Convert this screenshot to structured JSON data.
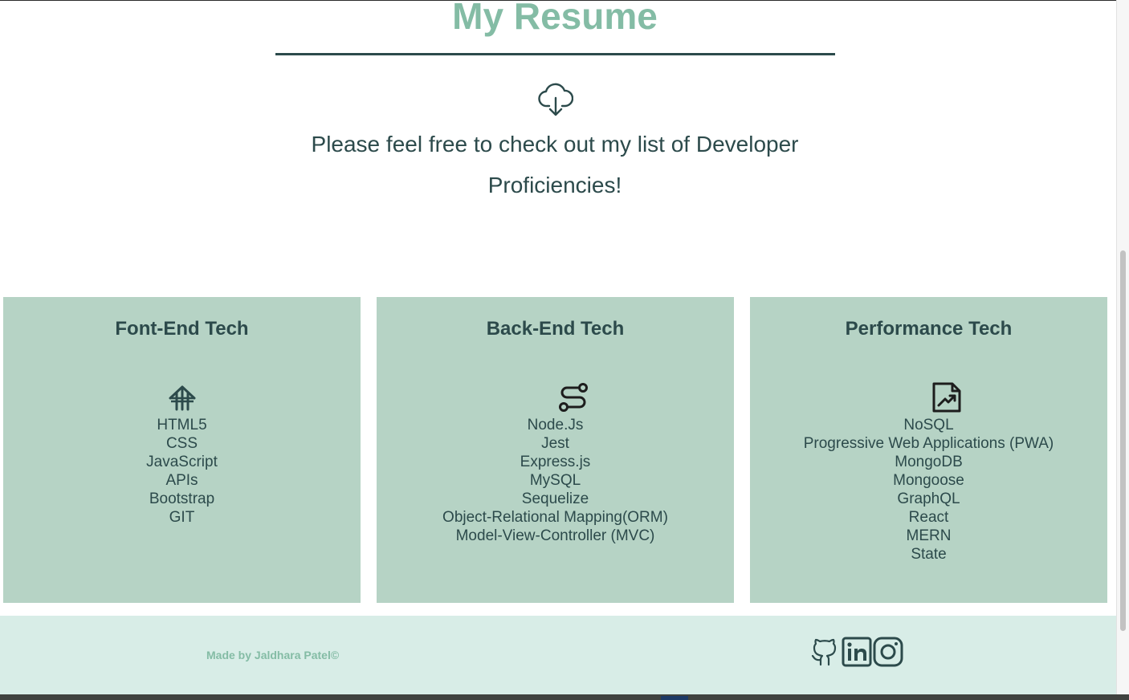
{
  "header": {
    "title": "My Resume",
    "download_icon": "cloud-download-icon",
    "intro_line1": "Please feel free to check out my list of Developer",
    "intro_line2": "Proficiencies!"
  },
  "cards": [
    {
      "title": "Font-End Tech",
      "icon": "frontend-icon",
      "items": [
        "HTML5",
        "CSS",
        "JavaScript",
        "APIs",
        "Bootstrap",
        "GIT"
      ]
    },
    {
      "title": "Back-End Tech",
      "icon": "route-icon",
      "items": [
        "Node.Js",
        "Jest",
        "Express.js",
        "MySQL",
        "Sequelize",
        "Object-Relational Mapping(ORM)",
        "Model-View-Controller (MVC)"
      ]
    },
    {
      "title": "Performance Tech",
      "icon": "file-chart-icon",
      "items": [
        "NoSQL",
        "Progressive Web Applications (PWA)",
        "MongoDB",
        "Mongoose",
        "GraphQL",
        "React",
        "MERN",
        "State"
      ]
    }
  ],
  "footer": {
    "credit": "Made by Jaldhara Patel©",
    "social": [
      "github-icon",
      "linkedin-icon",
      "instagram-icon"
    ]
  },
  "colors": {
    "accent": "#84bca5",
    "dark": "#2c4a4b",
    "card_bg": "#b6d3c5",
    "footer_bg": "#d8ede7"
  }
}
